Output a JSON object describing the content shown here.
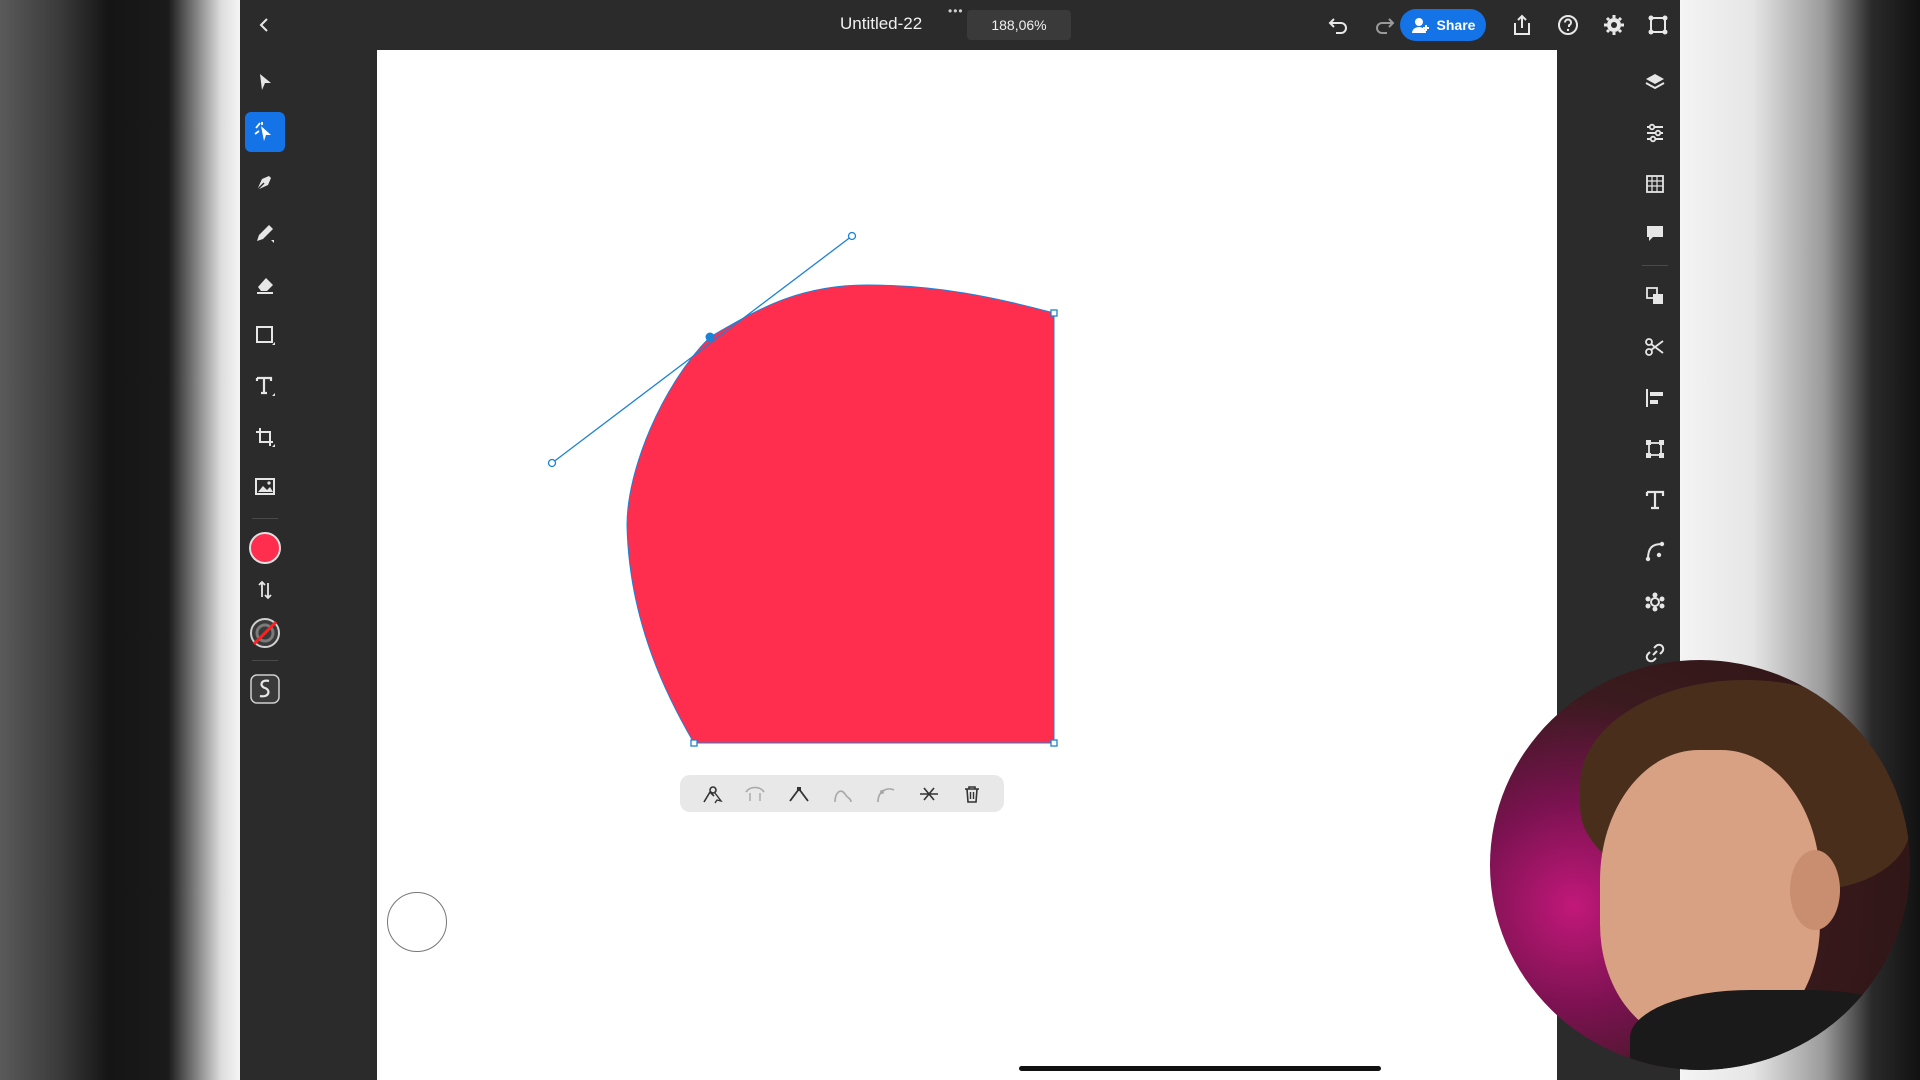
{
  "topbar": {
    "back_icon": "chevron-left-icon",
    "more_dots": "•••",
    "document_title": "Untitled-22",
    "zoom_level": "188,06%",
    "share_label": "Share",
    "icons": [
      "undo-icon",
      "redo-icon",
      "export-icon",
      "help-icon",
      "settings-icon",
      "shape-select-icon"
    ]
  },
  "left_toolbar": {
    "tools": [
      "selection-tool-icon",
      "direct-selection-tool-icon",
      "pen-tool-icon",
      "pencil-tool-icon",
      "eraser-tool-icon",
      "rectangle-tool-icon",
      "type-tool-icon",
      "artboard-tool-icon",
      "image-tool-icon"
    ],
    "active_tool": "direct-selection-tool-icon",
    "fill_color": "#ff2d4e",
    "stroke": "none"
  },
  "right_toolbar": {
    "panels": [
      "layers-icon",
      "properties-icon",
      "swatches-icon",
      "comments-icon",
      "arrange-icon",
      "cut-icon",
      "align-icon",
      "transform-icon",
      "text-properties-icon",
      "path-icon",
      "symbols-icon",
      "link-icon"
    ]
  },
  "canvas": {
    "shape_fill": "#ff2d4e",
    "selection_color": "#1b82d6"
  },
  "anchor_toolbar": {
    "tools": [
      "anchor-point-icon",
      "smooth-points-icon",
      "corner-point-icon",
      "remove-anchor-icon",
      "add-anchor-icon",
      "cut-path-icon",
      "delete-icon"
    ]
  }
}
